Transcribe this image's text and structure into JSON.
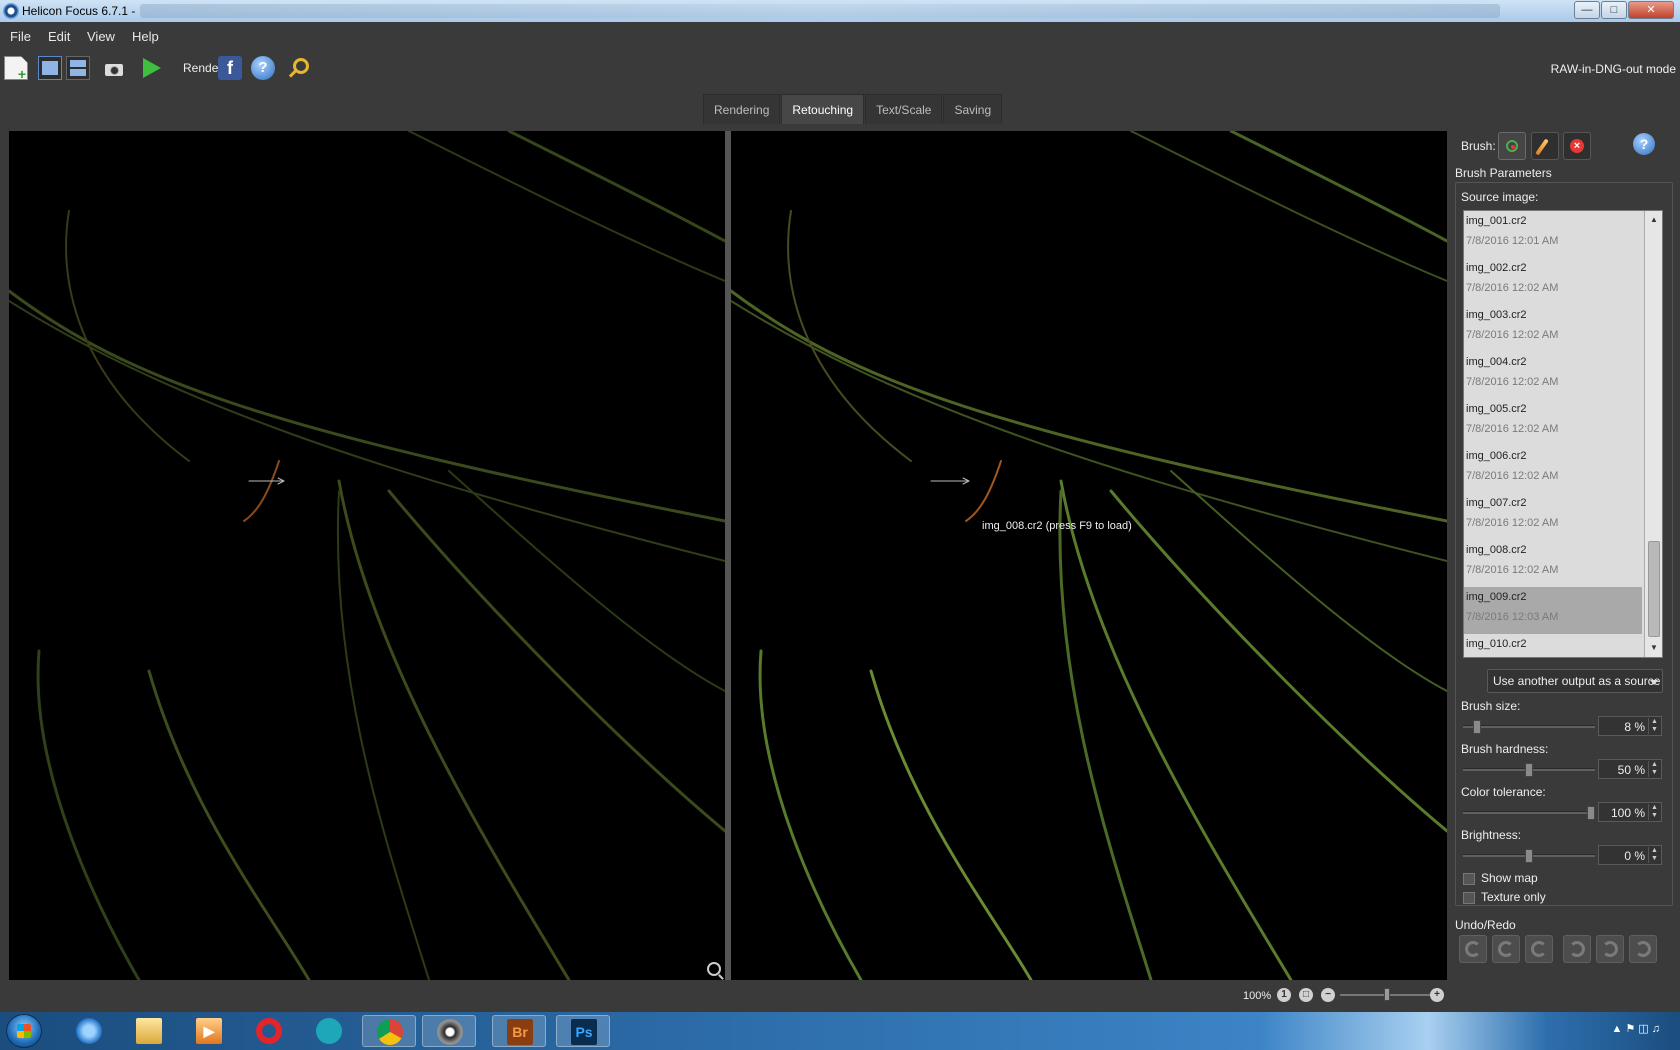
{
  "window": {
    "title": "Helicon Focus 6.7.1 -"
  },
  "menu": {
    "items": [
      "File",
      "Edit",
      "View",
      "Help"
    ]
  },
  "toolbar": {
    "render_label": "Render",
    "mode_label": "RAW-in-DNG-out mode"
  },
  "tabs": [
    {
      "label": "Rendering",
      "active": false
    },
    {
      "label": "Retouching",
      "active": true
    },
    {
      "label": "Text/Scale",
      "active": false
    },
    {
      "label": "Saving",
      "active": false
    }
  ],
  "viewer": {
    "overlay_hint": "img_008.cr2 (press F9 to load)"
  },
  "panel": {
    "brush_label": "Brush:",
    "brush_params_title": "Brush Parameters",
    "source_image_label": "Source image:",
    "sources": [
      {
        "name": "img_001.cr2",
        "date": "7/8/2016 12:01 AM"
      },
      {
        "name": "img_002.cr2",
        "date": "7/8/2016 12:02 AM"
      },
      {
        "name": "img_003.cr2",
        "date": "7/8/2016 12:02 AM"
      },
      {
        "name": "img_004.cr2",
        "date": "7/8/2016 12:02 AM"
      },
      {
        "name": "img_005.cr2",
        "date": "7/8/2016 12:02 AM"
      },
      {
        "name": "img_006.cr2",
        "date": "7/8/2016 12:02 AM"
      },
      {
        "name": "img_007.cr2",
        "date": "7/8/2016 12:02 AM"
      },
      {
        "name": "img_008.cr2",
        "date": "7/8/2016 12:02 AM"
      },
      {
        "name": "img_009.cr2",
        "date": "7/8/2016 12:03 AM",
        "selected": true
      },
      {
        "name": "img_010.cr2",
        "date": ""
      }
    ],
    "output_dropdown": "Use another output as a source",
    "sliders": [
      {
        "label": "Brush size:",
        "value": "8 %",
        "level": 0.08
      },
      {
        "label": "Brush hardness:",
        "value": "50 %",
        "level": 0.5
      },
      {
        "label": "Color tolerance:",
        "value": "100 %",
        "level": 1.0
      },
      {
        "label": "Brightness:",
        "value": "0 %",
        "level": 0.5
      }
    ],
    "checkboxes": [
      {
        "label": "Show map",
        "checked": false
      },
      {
        "label": "Texture only",
        "checked": false
      }
    ],
    "undo_redo_title": "Undo/Redo"
  },
  "zoom": {
    "percent": "100%",
    "level": 0.5
  }
}
